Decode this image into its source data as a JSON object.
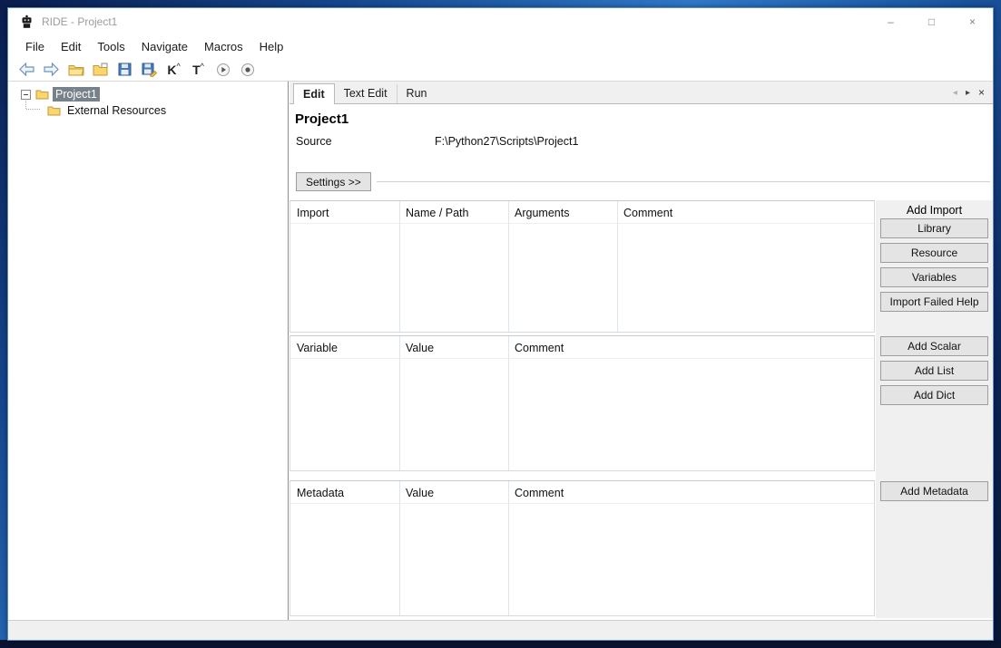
{
  "window": {
    "title": "RIDE - Project1",
    "minimize": "–",
    "maximize": "□",
    "close": "×"
  },
  "menubar": {
    "items": [
      "File",
      "Edit",
      "Tools",
      "Navigate",
      "Macros",
      "Help"
    ]
  },
  "toolbar": {
    "kw_search_label": "K",
    "kw_search_mark": "^",
    "test_search_label": "T",
    "test_search_mark": "^"
  },
  "tree": {
    "root_label": "Project1",
    "child_label": "External Resources"
  },
  "tabs": {
    "items": [
      "Edit",
      "Text Edit",
      "Run"
    ],
    "prev": "◂",
    "next": "▸",
    "close": "×"
  },
  "editor": {
    "title": "Project1",
    "source_label": "Source",
    "source_value": "F:\\Python27\\Scripts\\Project1",
    "settings_button": "Settings >>",
    "import_table": {
      "headers": [
        "Import",
        "Name / Path",
        "Arguments",
        "Comment"
      ]
    },
    "import_actions": {
      "label": "Add Import",
      "library": "Library",
      "resource": "Resource",
      "variables": "Variables",
      "help": "Import Failed Help"
    },
    "variable_table": {
      "headers": [
        "Variable",
        "Value",
        "Comment"
      ]
    },
    "variable_actions": {
      "scalar": "Add Scalar",
      "list": "Add List",
      "dict": "Add Dict"
    },
    "metadata_table": {
      "headers": [
        "Metadata",
        "Value",
        "Comment"
      ]
    },
    "metadata_actions": {
      "add": "Add Metadata"
    }
  },
  "colors": {
    "desktop_blue": "#2f79c9",
    "selection_gray": "#76818a",
    "folder_yellow": "#fbd56e",
    "window_border": "#5f8cbe"
  }
}
